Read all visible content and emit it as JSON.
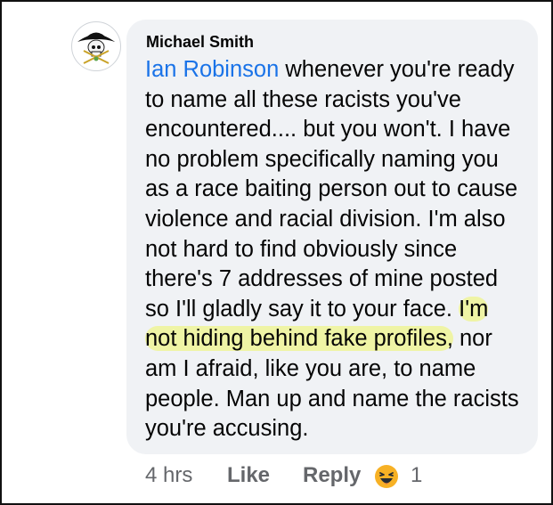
{
  "comment": {
    "author": "Michael Smith",
    "mention": "Ian Robinson",
    "lines": [
      " whenever you're ready",
      "to name all these racists you've",
      "encountered.... but you won't. I have",
      "no problem specifically naming you",
      "as a race baiting person out to cause",
      "violence and racial division. I'm also",
      "not hard to find obviously since",
      "there's 7 addresses of mine posted",
      "so I'll gladly say it to your face. "
    ],
    "highlight_line1": "I'm",
    "highlight_line2": "not hiding behind fake profiles,",
    "after_highlight": " nor",
    "tail_lines": [
      "am I afraid, like you are, to name",
      "people. Man up and name the racists",
      "you're accusing."
    ]
  },
  "actions": {
    "time": "4 hrs",
    "like": "Like",
    "reply": "Reply",
    "reaction_icon": "laughing-emoji-icon",
    "reaction_count": "1"
  },
  "colors": {
    "mention": "#1a73e8",
    "bubble": "#f0f2f5",
    "highlight": "#eef496",
    "meta": "#65676b"
  }
}
